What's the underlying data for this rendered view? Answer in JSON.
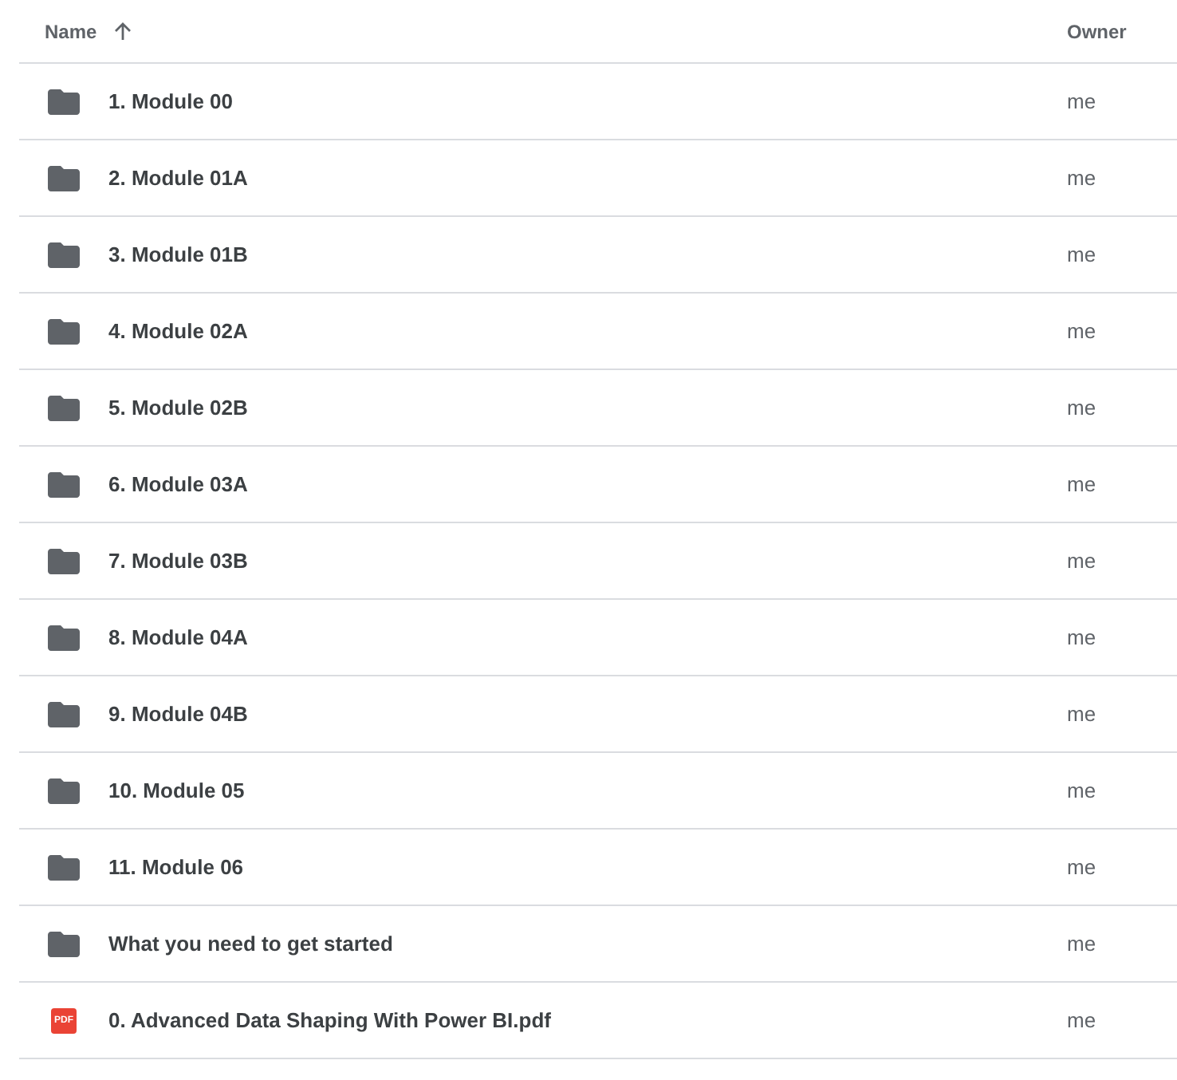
{
  "columns": [
    {
      "label": "Name",
      "sorted": true
    },
    {
      "label": "Owner"
    }
  ],
  "rows": [
    {
      "kind": "folder",
      "name": "1. Module 00",
      "owner": "me"
    },
    {
      "kind": "folder",
      "name": "2. Module 01A",
      "owner": "me"
    },
    {
      "kind": "folder",
      "name": "3. Module 01B",
      "owner": "me"
    },
    {
      "kind": "folder",
      "name": "4. Module 02A",
      "owner": "me"
    },
    {
      "kind": "folder",
      "name": "5. Module 02B",
      "owner": "me"
    },
    {
      "kind": "folder",
      "name": "6. Module 03A",
      "owner": "me"
    },
    {
      "kind": "folder",
      "name": "7. Module 03B",
      "owner": "me"
    },
    {
      "kind": "folder",
      "name": "8. Module 04A",
      "owner": "me"
    },
    {
      "kind": "folder",
      "name": "9. Module 04B",
      "owner": "me"
    },
    {
      "kind": "folder",
      "name": "10. Module 05",
      "owner": "me"
    },
    {
      "kind": "folder",
      "name": "11. Module 06",
      "owner": "me"
    },
    {
      "kind": "folder",
      "name": "What you need to get started",
      "owner": "me"
    },
    {
      "kind": "pdf",
      "name": "0. Advanced Data Shaping With Power BI.pdf",
      "owner": "me",
      "icon_label": "PDF"
    }
  ]
}
